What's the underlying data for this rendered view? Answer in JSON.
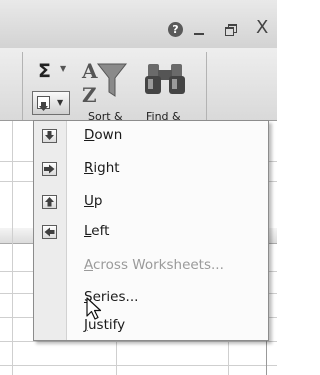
{
  "window": {
    "help_icon": "?",
    "close_icon": "X"
  },
  "ribbon": {
    "autosum_icon": "Σ",
    "sort_label": "Sort &",
    "find_label": "Find &"
  },
  "fill_menu": {
    "items": [
      {
        "label": "Down",
        "accel": "D",
        "rest": "own",
        "icon": "fill-down-icon",
        "enabled": true
      },
      {
        "label": "Right",
        "accel": "R",
        "rest": "ight",
        "icon": "fill-right-icon",
        "enabled": true
      },
      {
        "label": "Up",
        "accel": "U",
        "rest": "p",
        "icon": "fill-up-icon",
        "enabled": true
      },
      {
        "label": "Left",
        "accel": "L",
        "rest": "eft",
        "icon": "fill-left-icon",
        "enabled": true
      },
      {
        "label": "Across Worksheets...",
        "accel": "A",
        "rest": "cross Worksheets...",
        "icon": "",
        "enabled": false
      },
      {
        "label": "Series...",
        "accel": "S",
        "rest": "eries...",
        "icon": "",
        "enabled": true
      },
      {
        "label": "Justify",
        "accel": "J",
        "rest": "ustify",
        "icon": "",
        "enabled": true
      }
    ]
  },
  "colors": {
    "ribbon_bg": "#e3e3e3",
    "menu_bg": "#fbfbfb",
    "disabled_text": "#9a9a9a"
  }
}
